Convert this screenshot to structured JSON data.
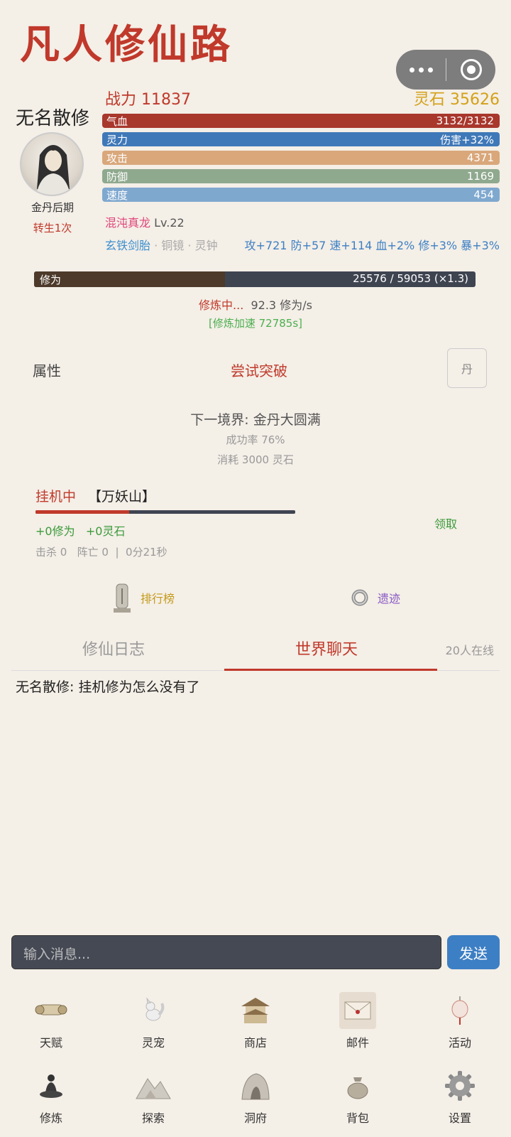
{
  "app": {
    "title": "凡人修仙路"
  },
  "player": {
    "name": "无名散修",
    "realm": "金丹后期",
    "rebirth": "转生1次",
    "power": "战力 11837",
    "stones": "灵石 35626"
  },
  "stats": [
    {
      "name": "气血",
      "value": "3132/3132",
      "color": "#a8372c"
    },
    {
      "name": "灵力",
      "value": "伤害+32%",
      "color": "#3f78b8"
    },
    {
      "name": "攻击",
      "value": "4371",
      "color": "#d9a77a"
    },
    {
      "name": "防御",
      "value": "1169",
      "color": "#8fa98e"
    },
    {
      "name": "速度",
      "value": "454",
      "color": "#7fa8cf"
    }
  ],
  "pet": {
    "name": "混沌真龙",
    "level": "Lv.22"
  },
  "equipment": {
    "items": [
      "玄铁剑胎",
      "铜镜",
      "灵钟"
    ],
    "bonus": "攻+721 防+57 速+114 血+2% 修+3% 暴+3%"
  },
  "cultivation": {
    "label": "修为",
    "value": "25576 / 59053 (×1.3)",
    "progress": 0.433,
    "status": "修炼中...",
    "rate": "92.3 修为/s",
    "accel": "[修炼加速 72785s]"
  },
  "actions": {
    "attributes": "属性",
    "breakthrough": "尝试突破",
    "pill": "丹"
  },
  "breakthrough_info": {
    "next": "下一境界: 金丹大圆满",
    "success": "成功率 76%",
    "cost": "消耗 3000 灵石"
  },
  "idle": {
    "status": "挂机中",
    "map": "【万妖山】",
    "progress": 0.36,
    "gain_cultivation": "+0修为",
    "gain_stones": "+0灵石",
    "claim": "领取",
    "stats": "击杀 0   阵亡 0  |  0分21秒"
  },
  "quick_links": {
    "ranking": "排行榜",
    "ruins": "遗迹"
  },
  "tabs": {
    "log": "修仙日志",
    "chat": "世界聊天",
    "online": "20人在线"
  },
  "chat": {
    "messages": [
      {
        "text": "无名散修: 挂机修为怎么没有了"
      }
    ],
    "placeholder": "输入消息...",
    "send": "发送"
  },
  "nav": {
    "row1": [
      {
        "label": "天赋",
        "icon": "scroll-icon"
      },
      {
        "label": "灵宠",
        "icon": "fox-icon"
      },
      {
        "label": "商店",
        "icon": "pavilion-icon"
      },
      {
        "label": "邮件",
        "icon": "envelope-icon"
      },
      {
        "label": "活动",
        "icon": "lantern-icon"
      }
    ],
    "row2": [
      {
        "label": "修炼",
        "icon": "meditation-icon"
      },
      {
        "label": "探索",
        "icon": "mountain-icon"
      },
      {
        "label": "洞府",
        "icon": "cave-icon"
      },
      {
        "label": "背包",
        "icon": "bag-icon"
      },
      {
        "label": "设置",
        "icon": "gear-icon"
      }
    ]
  }
}
